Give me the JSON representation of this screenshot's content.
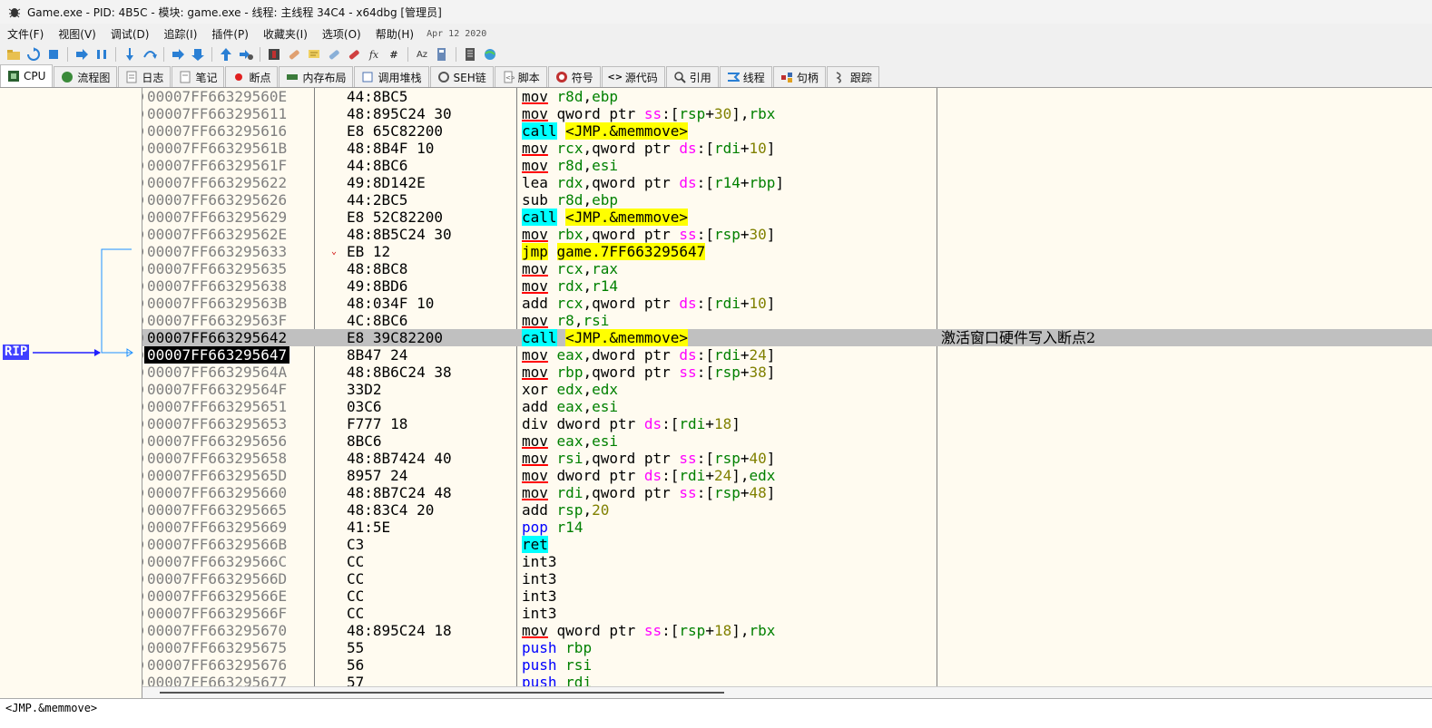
{
  "window": {
    "title": "Game.exe - PID: 4B5C - 模块: game.exe - 线程: 主线程 34C4 - x64dbg [管理员]"
  },
  "menu": {
    "items": [
      "文件(F)",
      "视图(V)",
      "调试(D)",
      "追踪(I)",
      "插件(P)",
      "收藏夹(I)",
      "选项(O)",
      "帮助(H)"
    ],
    "date": "Apr 12 2020"
  },
  "toolbar": {
    "icons": [
      "open-icon",
      "restart-icon",
      "stop-icon",
      "run-icon",
      "pause-icon",
      "step-into-icon",
      "step-over-icon",
      "step-into-down-icon",
      "step-over-down-icon",
      "execute-till-return-icon",
      "run-to-user-code-icon",
      "trace-icon",
      "patch-icon",
      "comment-icon",
      "label-icon",
      "bookmark-icon",
      "function-icon",
      "hash-icon",
      "strings-icon",
      "calculator-icon",
      "notes-icon",
      "globe-icon"
    ]
  },
  "tabs": [
    "CPU",
    "流程图",
    "日志",
    "笔记",
    "断点",
    "内存布局",
    "调用堆栈",
    "SEH链",
    "脚本",
    "符号",
    "源代码",
    "引用",
    "线程",
    "句柄",
    "跟踪"
  ],
  "rip_label": "RIP",
  "rows": [
    {
      "addr": "00007FF66329560E",
      "bytes": "44:8BC5",
      "mn": "mov",
      "op": "r8d,ebp",
      "kind": "mov"
    },
    {
      "addr": "00007FF663295611",
      "bytes": "48:895C24 30",
      "mn": "mov",
      "op": "qword ptr ss:[rsp+30],rbx",
      "kind": "mov"
    },
    {
      "addr": "00007FF663295616",
      "bytes": "E8 65C82200",
      "mn": "call",
      "op": "<JMP.&memmove>",
      "kind": "call"
    },
    {
      "addr": "00007FF66329561B",
      "bytes": "48:8B4F 10",
      "mn": "mov",
      "op": "rcx,qword ptr ds:[rdi+10]",
      "kind": "mov"
    },
    {
      "addr": "00007FF66329561F",
      "bytes": "44:8BC6",
      "mn": "mov",
      "op": "r8d,esi",
      "kind": "mov"
    },
    {
      "addr": "00007FF663295622",
      "bytes": "49:8D142E",
      "mn": "lea",
      "op": "rdx,qword ptr ds:[r14+rbp]",
      "kind": "plain"
    },
    {
      "addr": "00007FF663295626",
      "bytes": "44:2BC5",
      "mn": "sub",
      "op": "r8d,ebp",
      "kind": "plain"
    },
    {
      "addr": "00007FF663295629",
      "bytes": "E8 52C82200",
      "mn": "call",
      "op": "<JMP.&memmove>",
      "kind": "call"
    },
    {
      "addr": "00007FF66329562E",
      "bytes": "48:8B5C24 30",
      "mn": "mov",
      "op": "rbx,qword ptr ss:[rsp+30]",
      "kind": "mov"
    },
    {
      "addr": "00007FF663295633",
      "bytes": "EB 12",
      "mn": "jmp",
      "op": "game.7FF663295647",
      "kind": "jmp"
    },
    {
      "addr": "00007FF663295635",
      "bytes": "48:8BC8",
      "mn": "mov",
      "op": "rcx,rax",
      "kind": "mov"
    },
    {
      "addr": "00007FF663295638",
      "bytes": "49:8BD6",
      "mn": "mov",
      "op": "rdx,r14",
      "kind": "mov"
    },
    {
      "addr": "00007FF66329563B",
      "bytes": "48:034F 10",
      "mn": "add",
      "op": "rcx,qword ptr ds:[rdi+10]",
      "kind": "plain"
    },
    {
      "addr": "00007FF66329563F",
      "bytes": "4C:8BC6",
      "mn": "mov",
      "op": "r8,rsi",
      "kind": "mov"
    },
    {
      "addr": "00007FF663295642",
      "bytes": "E8 39C82200",
      "mn": "call",
      "op": "<JMP.&memmove>",
      "kind": "call",
      "comment": "激活窗口硬件写入断点2"
    },
    {
      "addr": "00007FF663295647",
      "bytes": "8B47 24",
      "mn": "mov",
      "op": "eax,dword ptr ds:[rdi+24]",
      "kind": "mov"
    },
    {
      "addr": "00007FF66329564A",
      "bytes": "48:8B6C24 38",
      "mn": "mov",
      "op": "rbp,qword ptr ss:[rsp+38]",
      "kind": "mov"
    },
    {
      "addr": "00007FF66329564F",
      "bytes": "33D2",
      "mn": "xor",
      "op": "edx,edx",
      "kind": "plain"
    },
    {
      "addr": "00007FF663295651",
      "bytes": "03C6",
      "mn": "add",
      "op": "eax,esi",
      "kind": "plain"
    },
    {
      "addr": "00007FF663295653",
      "bytes": "F777 18",
      "mn": "div",
      "op": "dword ptr ds:[rdi+18]",
      "kind": "plain"
    },
    {
      "addr": "00007FF663295656",
      "bytes": "8BC6",
      "mn": "mov",
      "op": "eax,esi",
      "kind": "mov"
    },
    {
      "addr": "00007FF663295658",
      "bytes": "48:8B7424 40",
      "mn": "mov",
      "op": "rsi,qword ptr ss:[rsp+40]",
      "kind": "mov"
    },
    {
      "addr": "00007FF66329565D",
      "bytes": "8957 24",
      "mn": "mov",
      "op": "dword ptr ds:[rdi+24],edx",
      "kind": "mov"
    },
    {
      "addr": "00007FF663295660",
      "bytes": "48:8B7C24 48",
      "mn": "mov",
      "op": "rdi,qword ptr ss:[rsp+48]",
      "kind": "mov"
    },
    {
      "addr": "00007FF663295665",
      "bytes": "48:83C4 20",
      "mn": "add",
      "op": "rsp,20",
      "kind": "plain"
    },
    {
      "addr": "00007FF663295669",
      "bytes": "41:5E",
      "mn": "pop",
      "op": "r14",
      "kind": "stack"
    },
    {
      "addr": "00007FF66329566B",
      "bytes": "C3",
      "mn": "ret",
      "op": "",
      "kind": "ret"
    },
    {
      "addr": "00007FF66329566C",
      "bytes": "CC",
      "mn": "int3",
      "op": "",
      "kind": "plain"
    },
    {
      "addr": "00007FF66329566D",
      "bytes": "CC",
      "mn": "int3",
      "op": "",
      "kind": "plain"
    },
    {
      "addr": "00007FF66329566E",
      "bytes": "CC",
      "mn": "int3",
      "op": "",
      "kind": "plain"
    },
    {
      "addr": "00007FF66329566F",
      "bytes": "CC",
      "mn": "int3",
      "op": "",
      "kind": "plain"
    },
    {
      "addr": "00007FF663295670",
      "bytes": "48:895C24 18",
      "mn": "mov",
      "op": "qword ptr ss:[rsp+18],rbx",
      "kind": "mov"
    },
    {
      "addr": "00007FF663295675",
      "bytes": "55",
      "mn": "push",
      "op": "rbp",
      "kind": "stack"
    },
    {
      "addr": "00007FF663295676",
      "bytes": "56",
      "mn": "push",
      "op": "rsi",
      "kind": "stack"
    },
    {
      "addr": "00007FF663295677",
      "bytes": "57",
      "mn": "push",
      "op": "rdi",
      "kind": "stack"
    }
  ],
  "highlight_row": 14,
  "current_row": 15,
  "jump_from_row": 9,
  "status_text": "<JMP.&memmove>",
  "colors": {
    "call_bg": "#00ffff",
    "call_target_bg": "#ffff00",
    "jmp_bg": "#ffff00",
    "reg": "#008000",
    "seg": "#ff00ff",
    "num": "#808000",
    "stack": "#0000ff",
    "mov_underline": "#ff0000",
    "rip_bg": "#4040ff",
    "arrow": "#1e90ff"
  }
}
